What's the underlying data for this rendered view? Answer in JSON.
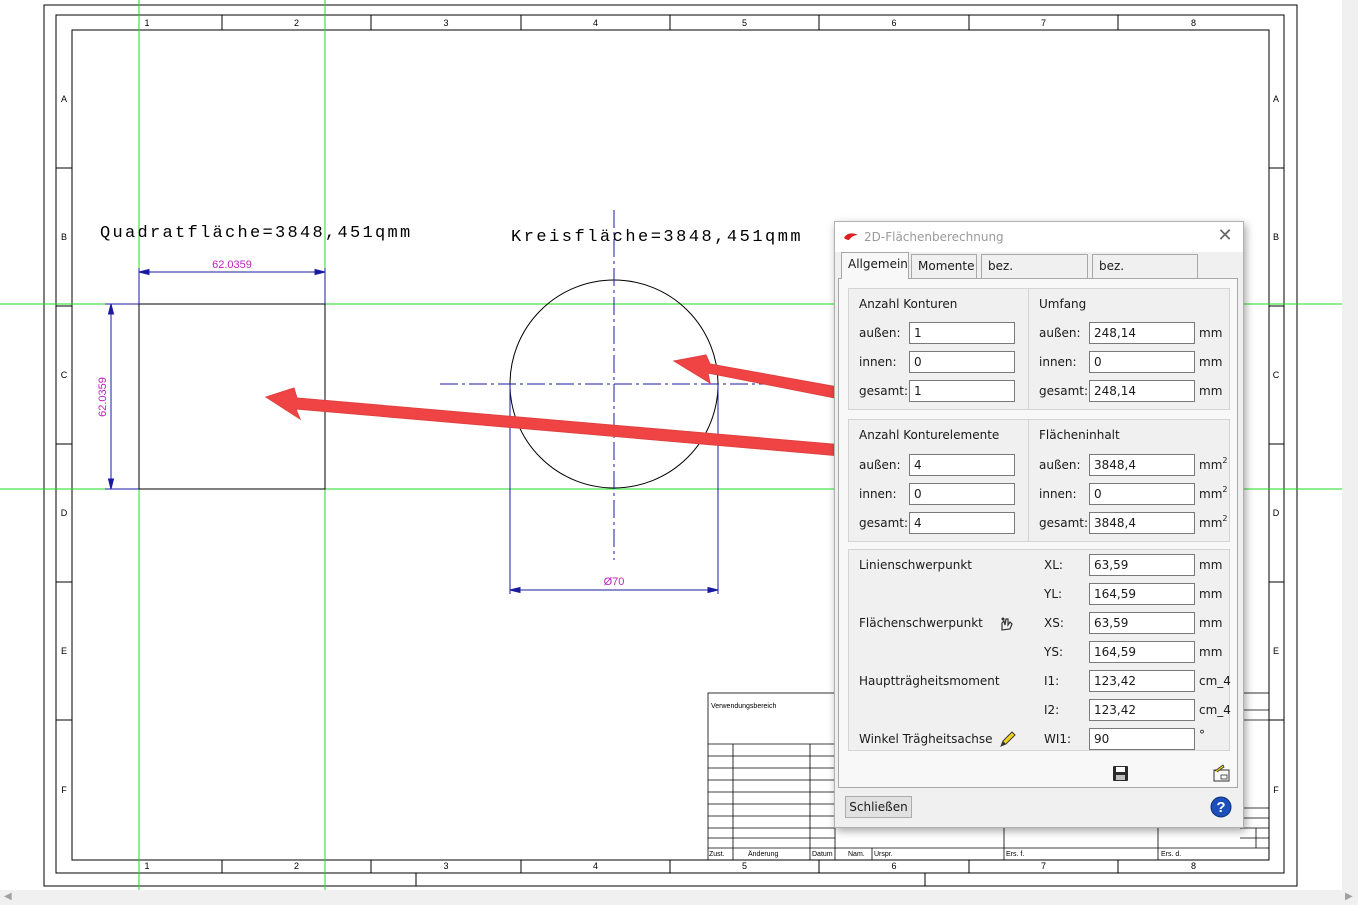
{
  "drawing": {
    "col_numbers": [
      "1",
      "2",
      "3",
      "4",
      "5",
      "6",
      "7",
      "8"
    ],
    "row_letters": [
      "A",
      "B",
      "C",
      "D",
      "E",
      "F"
    ],
    "label_square": "Quadratfläche=3848,451qmm",
    "label_circle": "Kreisfläche=3848,451qmm",
    "dim_square_h": "62.0359",
    "dim_square_v": "62.0359",
    "dim_circle": "Ø70",
    "titleblock": {
      "verwendungsbereich": "Verwendungsbereich",
      "zust": "Zust.",
      "aenderung": "Änderung",
      "datum": "Datum",
      "name": "Nam.",
      "urspr": "Urspr.",
      "ers_f": "Ers. f.",
      "ers_d": "Ers. d."
    }
  },
  "dialog": {
    "title": "2D-Flächenberechnung",
    "tabs": [
      "Allgemein",
      "Momente",
      "bez. Schwerpunkt",
      "bez. Koordinaten"
    ],
    "active_tab": "Allgemein",
    "anzahl_konturen": {
      "title": "Anzahl Konturen",
      "aussen_label": "außen:",
      "aussen": "1",
      "innen_label": "innen:",
      "innen": "0",
      "gesamt_label": "gesamt:",
      "gesamt": "1"
    },
    "umfang": {
      "title": "Umfang",
      "aussen_label": "außen:",
      "aussen": "248,14",
      "innen_label": "innen:",
      "innen": "0",
      "gesamt_label": "gesamt:",
      "gesamt": "248,14",
      "unit": "mm"
    },
    "anzahl_konturelemente": {
      "title": "Anzahl Konturelemente",
      "aussen_label": "außen:",
      "aussen": "4",
      "innen_label": "innen:",
      "innen": "0",
      "gesamt_label": "gesamt:",
      "gesamt": "4"
    },
    "flaecheninhalt": {
      "title": "Flächeninhalt",
      "aussen_label": "außen:",
      "aussen": "3848,4",
      "innen_label": "innen:",
      "innen": "0",
      "gesamt_label": "gesamt:",
      "gesamt": "3848,4",
      "unit": "mm",
      "unit_sup": "2"
    },
    "props": {
      "linienschwerpunkt": "Linienschwerpunkt",
      "flaechenschwerpunkt": "Flächenschwerpunkt",
      "haupttraegheitsmoment": "Hauptträgheitsmoment",
      "winkel": "Winkel Trägheitsachse",
      "xl_label": "XL:",
      "xl": "63,59",
      "xl_unit": "mm",
      "yl_label": "YL:",
      "yl": "164,59",
      "yl_unit": "mm",
      "xs_label": "XS:",
      "xs": "63,59",
      "xs_unit": "mm",
      "ys_label": "YS:",
      "ys": "164,59",
      "ys_unit": "mm",
      "i1_label": "I1:",
      "i1": "123,42",
      "i1_unit": "cm_4",
      "i2_label": "I2:",
      "i2": "123,42",
      "i2_unit": "cm_4",
      "wi1_label": "WI1:",
      "wi1": "90",
      "wi1_unit": "°"
    },
    "close_button": "Schließen"
  },
  "colors": {
    "construction_line": "#22dd22",
    "dimension": "#1a1aa0",
    "dimension_text": "#c020c0",
    "annotation_arrow": "#f04444"
  }
}
